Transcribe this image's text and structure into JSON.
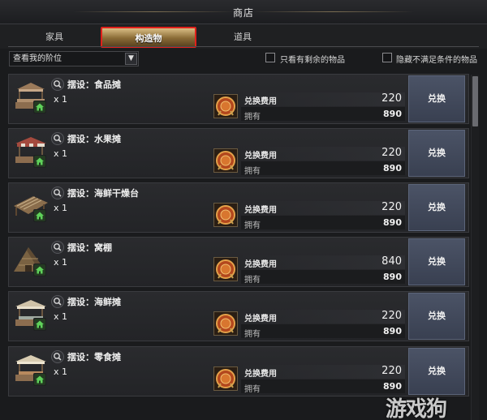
{
  "window": {
    "title": "商店"
  },
  "tabs": [
    {
      "label": "家具",
      "active": false
    },
    {
      "label": "构造物",
      "active": true
    },
    {
      "label": "道具",
      "active": false
    }
  ],
  "filters": {
    "tier_dropdown": "查看我的阶位",
    "only_remaining_label": "只看有剩余的物品",
    "hide_unmet_label": "隐藏不满足条件的物品"
  },
  "labels": {
    "cost": "兑换费用",
    "owned": "拥有",
    "exchange": "兑换"
  },
  "items": [
    {
      "name": "摆设：食品摊",
      "qty": "x 1",
      "cost": "220",
      "owned": "890",
      "kind": "food-stall-icon"
    },
    {
      "name": "摆设：水果摊",
      "qty": "x 1",
      "cost": "220",
      "owned": "890",
      "kind": "fruit-stall-icon"
    },
    {
      "name": "摆设：海鲜干燥台",
      "qty": "x 1",
      "cost": "220",
      "owned": "890",
      "kind": "drying-rack-icon"
    },
    {
      "name": "摆设：窝棚",
      "qty": "x 1",
      "cost": "840",
      "owned": "890",
      "kind": "shack-icon"
    },
    {
      "name": "摆设：海鲜摊",
      "qty": "x 1",
      "cost": "220",
      "owned": "890",
      "kind": "seafood-stall-icon"
    },
    {
      "name": "摆设：零食摊",
      "qty": "x 1",
      "cost": "220",
      "owned": "890",
      "kind": "snack-stall-icon"
    }
  ],
  "watermark": "游戏狗",
  "colors": {
    "active_tab_border": "#e0211b",
    "exchange_button": "#434a5c"
  }
}
